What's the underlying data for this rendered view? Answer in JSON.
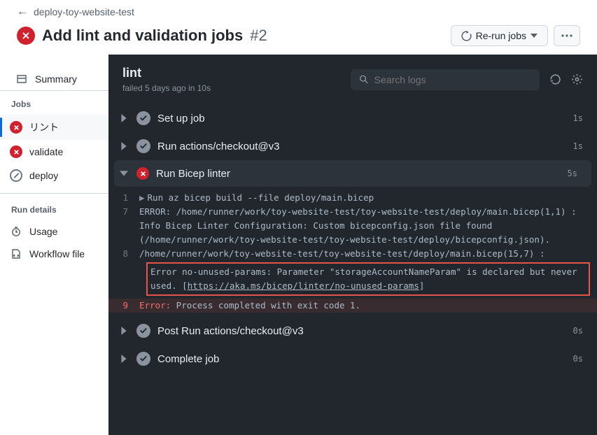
{
  "breadcrumb": {
    "repo": "deploy-toy-website-test"
  },
  "title": {
    "text": "Add lint and validation jobs",
    "number": "#2"
  },
  "buttons": {
    "rerun": "Re-run jobs"
  },
  "sidebar": {
    "summary": "Summary",
    "jobs_label": "Jobs",
    "jobs": [
      {
        "label": "リント",
        "status": "fail"
      },
      {
        "label": "validate",
        "status": "fail"
      },
      {
        "label": "deploy",
        "status": "neutral"
      }
    ],
    "run_details_label": "Run details",
    "usage": "Usage",
    "workflow_file": "Workflow file"
  },
  "log": {
    "title": "lint",
    "sub": "failed 5 days ago in 10s",
    "search_placeholder": "Search logs",
    "steps": [
      {
        "name": "Set up job",
        "time": "1s",
        "status": "ok",
        "expanded": false
      },
      {
        "name": "Run actions/checkout@v3",
        "time": "1s",
        "status": "ok",
        "expanded": false
      },
      {
        "name": "Run Bicep linter",
        "time": "5s",
        "status": "fail",
        "expanded": true
      },
      {
        "name": "Post Run actions/checkout@v3",
        "time": "0s",
        "status": "ok",
        "expanded": false
      },
      {
        "name": "Complete job",
        "time": "0s",
        "status": "ok",
        "expanded": false
      }
    ],
    "linter_lines": {
      "l1_num": "1",
      "l1": "Run az bicep build --file deploy/main.bicep",
      "l7_num": "7",
      "l7a": "ERROR: /home/runner/work/toy-website-test/toy-website-test/deploy/main.bicep(1,1) : Info Bicep Linter Configuration: Custom bicepconfig.json file found (/home/runner/work/toy-website-test/toy-website-test/deploy/bicepconfig.json).",
      "l8_num": "8",
      "l8a": "/home/runner/work/toy-website-test/toy-website-test/deploy/main.bicep(15,7) : ",
      "l8b_pre": "Error no-unused-params: Parameter \"storageAccountNameParam\" is declared but never used. [",
      "l8b_link": "https://aka.ms/bicep/linter/no-unused-params",
      "l8b_post": "]",
      "l9_num": "9",
      "l9a": "Error:",
      "l9b": " Process completed with exit code 1."
    }
  }
}
